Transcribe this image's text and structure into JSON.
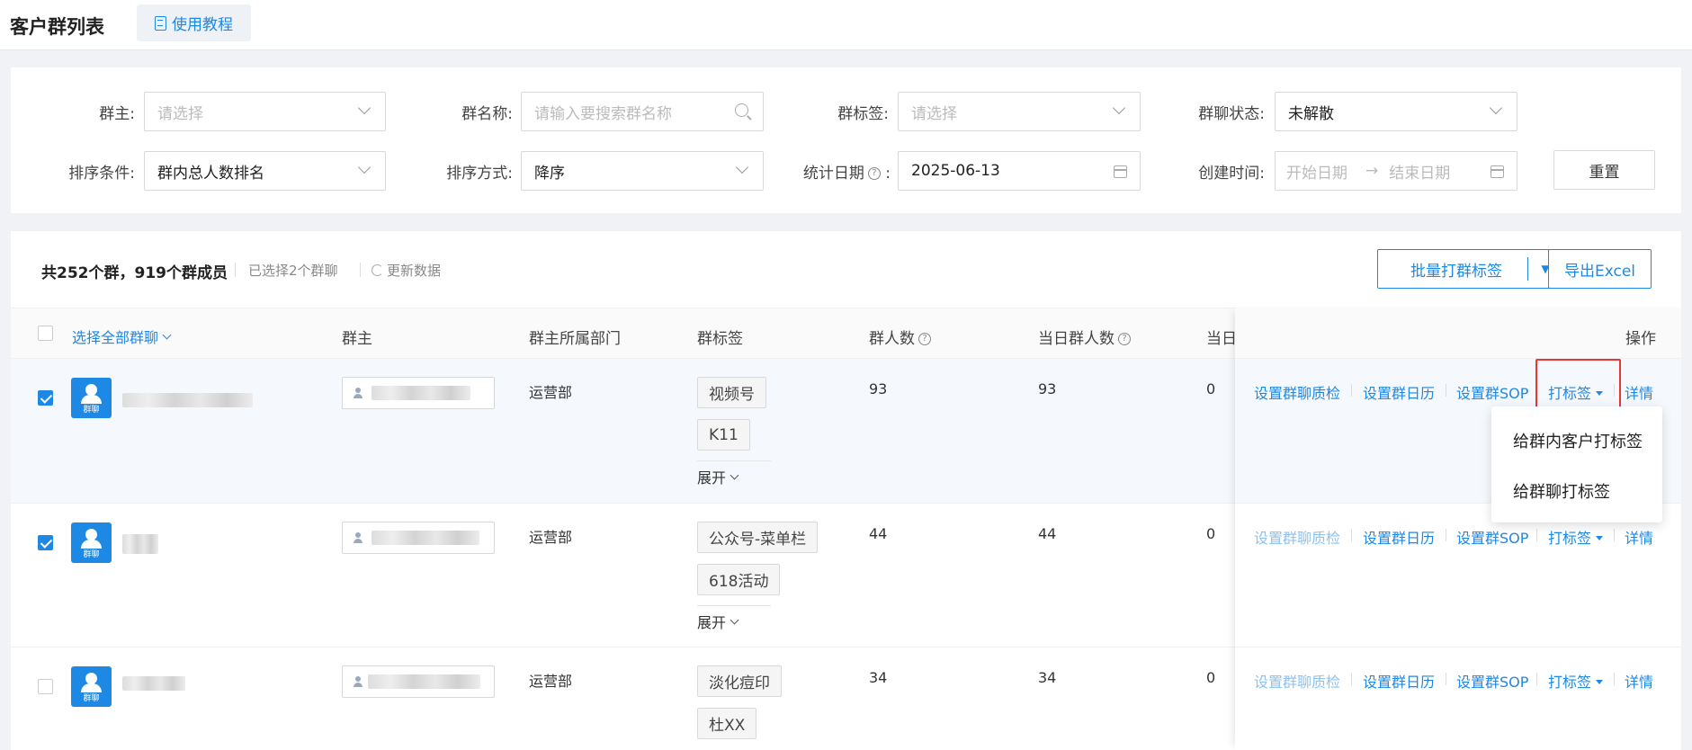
{
  "header": {
    "title": "客户群列表",
    "tutorial_label": "使用教程"
  },
  "filters": {
    "owner": {
      "label": "群主:",
      "placeholder": "请选择"
    },
    "group_name": {
      "label": "群名称:",
      "placeholder": "请输入要搜索群名称"
    },
    "group_tag": {
      "label": "群标签:",
      "placeholder": "请选择"
    },
    "group_status": {
      "label": "群聊状态:",
      "value": "未解散"
    },
    "sort_condition": {
      "label": "排序条件:",
      "value": "群内总人数排名"
    },
    "sort_order": {
      "label": "排序方式:",
      "value": "降序"
    },
    "stat_date": {
      "label": "统计日期",
      "suffix": ":",
      "value": "2025-06-13"
    },
    "created_time": {
      "label": "创建时间:",
      "start_placeholder": "开始日期",
      "end_placeholder": "结束日期",
      "arrow": "→"
    },
    "reset_label": "重置"
  },
  "toolbar": {
    "summary": "共252个群，919个群成员",
    "selected": "已选择2个群聊",
    "refresh": "更新数据",
    "batch_tag": "批量打群标签",
    "export": "导出Excel"
  },
  "table": {
    "select_all": "选择全部群聊",
    "columns": {
      "owner": "群主",
      "dept": "群主所属部门",
      "tags": "群标签",
      "members": "群人数",
      "today_members": "当日群人数",
      "today_cut": "当日",
      "actions": "操作"
    },
    "avatar_label": "群聊",
    "expand_label": "展开",
    "rows": [
      {
        "checked": true,
        "dept": "运营部",
        "tags": [
          "视频号",
          "K11"
        ],
        "members": "93",
        "today_members": "93",
        "today_other": "0"
      },
      {
        "checked": true,
        "dept": "运营部",
        "tags": [
          "公众号-菜单栏",
          "618活动"
        ],
        "members": "44",
        "today_members": "44",
        "today_other": "0"
      },
      {
        "checked": false,
        "dept": "运营部",
        "tags": [
          "淡化痘印",
          "杜XX"
        ],
        "members": "34",
        "today_members": "34",
        "today_other": "0"
      }
    ],
    "actions": {
      "quality": "设置群聊质检",
      "calendar": "设置群日历",
      "sop": "设置群SOP",
      "tag": "打标签",
      "detail": "详情"
    }
  },
  "tag_menu": {
    "items": [
      "给群内客户打标签",
      "给群聊打标签"
    ]
  }
}
